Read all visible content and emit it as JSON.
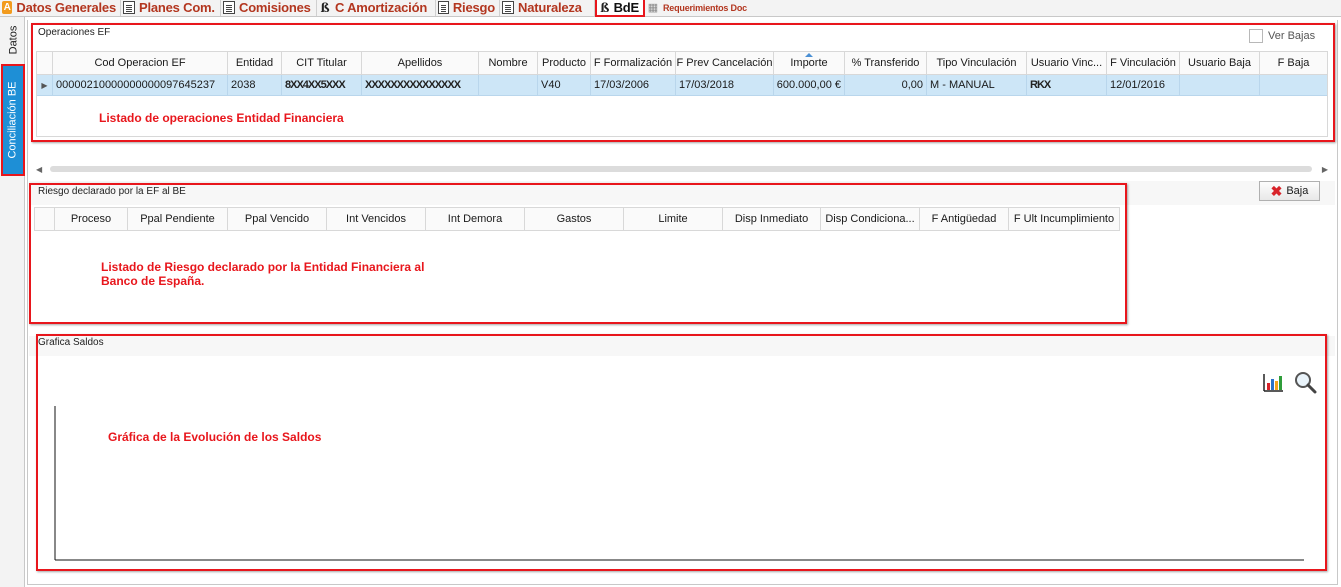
{
  "tabs": [
    {
      "label": "Datos Generales",
      "icon": "orange-a-icon"
    },
    {
      "label": "Planes Com.",
      "icon": "document-icon"
    },
    {
      "label": "Comisiones",
      "icon": "document-icon"
    },
    {
      "label": "C Amortización",
      "icon": "beta-icon"
    },
    {
      "label": "Riesgo",
      "icon": "document-icon"
    },
    {
      "label": "Naturaleza",
      "icon": "document-icon"
    },
    {
      "label": "BdE",
      "icon": "beta-icon"
    },
    {
      "label": "Requerimientos Doc",
      "icon": "calendar-icon"
    }
  ],
  "side_tabs": {
    "datos": "Datos",
    "conciliacion": "Conciliación BE"
  },
  "operaciones": {
    "title": "Operaciones EF",
    "ver_bajas_label": "Ver Bajas",
    "columns": [
      "Cod Operacion EF",
      "Entidad",
      "CIT Titular",
      "Apellidos",
      "Nombre",
      "Producto",
      "F Formalización",
      "F Prev Cancelación",
      "Importe",
      "% Transferido",
      "Tipo Vinculación",
      "Usuario Vinc...",
      "F Vinculación",
      "Usuario Baja",
      "F Baja"
    ],
    "row": {
      "cod_operacion": "00000210000000000097645237",
      "entidad": "2038",
      "cit_titular": "8XX4XX5XXX",
      "apellidos": "XXXXXXXXXXXXXXX",
      "nombre": "",
      "producto": "V40",
      "f_formalizacion": "17/03/2006",
      "f_prev_cancelacion": "17/03/2018",
      "importe": "600.000,00 €",
      "transferido": "0,00",
      "tipo_vinculacion": "M - MANUAL",
      "usuario_vinc": "RKX",
      "f_vinculacion": "12/01/2016",
      "usuario_baja": "",
      "f_baja": ""
    },
    "annotation": "Listado de operaciones Entidad Financiera"
  },
  "riesgo": {
    "title": "Riesgo declarado por la EF al BE",
    "baja_label": "Baja",
    "columns": [
      "Proceso",
      "Ppal Pendiente",
      "Ppal Vencido",
      "Int Vencidos",
      "Int Demora",
      "Gastos",
      "Limite",
      "Disp Inmediato",
      "Disp Condiciona...",
      "F Antigüedad",
      "F Ult Incumplimiento"
    ],
    "annotation_line1": "Listado de Riesgo declarado por la Entidad Financiera al",
    "annotation_line2": "Banco de España."
  },
  "grafica": {
    "title": "Grafica Saldos",
    "annotation": "Gráfica de la Evolución de los Saldos"
  },
  "colors": {
    "tab_label": "#b3361f",
    "annotation_red": "#e8161c",
    "row_selected": "#cde6f7",
    "side_tab_active": "#1e8fd6"
  }
}
